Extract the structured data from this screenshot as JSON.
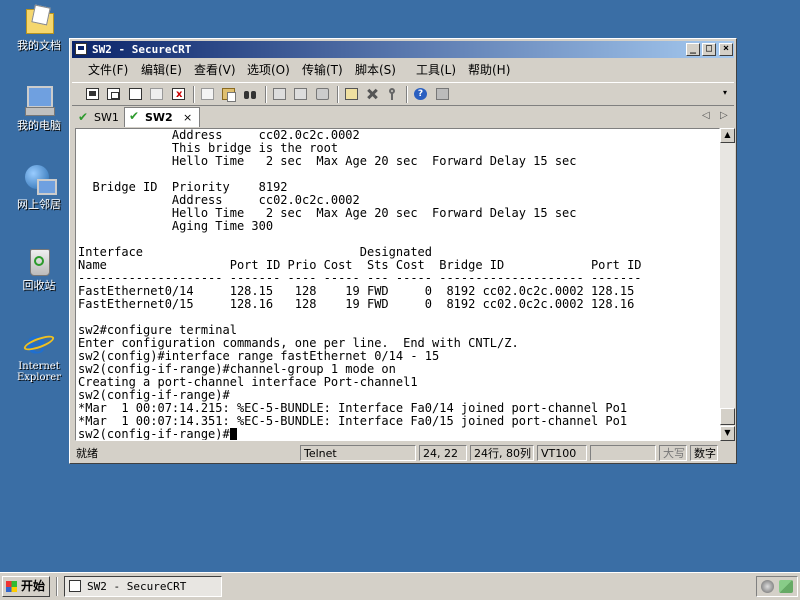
{
  "desktop": {
    "icons": [
      {
        "label": "我的文档"
      },
      {
        "label": "我的电脑"
      },
      {
        "label": "网上邻居"
      },
      {
        "label": "回收站"
      },
      {
        "label": "Internet Explorer"
      }
    ]
  },
  "window": {
    "title": "SW2 - SecureCRT",
    "controls": {
      "minimize": "_",
      "maximize": "□",
      "close": "×"
    },
    "menu": [
      "文件(F)",
      "编辑(E)",
      "查看(V)",
      "选项(O)",
      "传输(T)",
      "脚本(S)",
      "工具(L)",
      "帮助(H)"
    ],
    "tabs": [
      {
        "label": "SW1",
        "active": false
      },
      {
        "label": "SW2",
        "active": true
      }
    ],
    "tab_close": "×",
    "tab_nav": {
      "left": "◁",
      "right": "▷"
    },
    "terminal": {
      "lines": [
        "             Address     cc02.0c2c.0002",
        "             This bridge is the root",
        "             Hello Time   2 sec  Max Age 20 sec  Forward Delay 15 sec",
        "",
        "  Bridge ID  Priority    8192",
        "             Address     cc02.0c2c.0002",
        "             Hello Time   2 sec  Max Age 20 sec  Forward Delay 15 sec",
        "             Aging Time 300",
        "",
        "Interface                              Designated",
        "Name                 Port ID Prio Cost  Sts Cost  Bridge ID            Port ID",
        "-------------------- ------- ---- ----- --- ----- -------------------- -------",
        "FastEthernet0/14     128.15   128    19 FWD     0  8192 cc02.0c2c.0002 128.15",
        "FastEthernet0/15     128.16   128    19 FWD     0  8192 cc02.0c2c.0002 128.16",
        "",
        "sw2#configure terminal",
        "Enter configuration commands, one per line.  End with CNTL/Z.",
        "sw2(config)#interface range fastEthernet 0/14 - 15",
        "sw2(config-if-range)#channel-group 1 mode on",
        "Creating a port-channel interface Port-channel1",
        "sw2(config-if-range)#",
        "*Mar  1 00:07:14.215: %EC-5-BUNDLE: Interface Fa0/14 joined port-channel Po1",
        "*Mar  1 00:07:14.351: %EC-5-BUNDLE: Interface Fa0/15 joined port-channel Po1"
      ],
      "prompt": "sw2(config-if-range)#"
    },
    "scroll": {
      "up": "▲",
      "down": "▼"
    },
    "status": {
      "ready": "就绪",
      "protocol": "Telnet",
      "cursor_pos": "24, 22",
      "size": "24行, 80列",
      "emulation": "VT100",
      "caps": "大写",
      "num": "数字"
    }
  },
  "taskbar": {
    "start": "开始",
    "task": "SW2 - SecureCRT"
  }
}
